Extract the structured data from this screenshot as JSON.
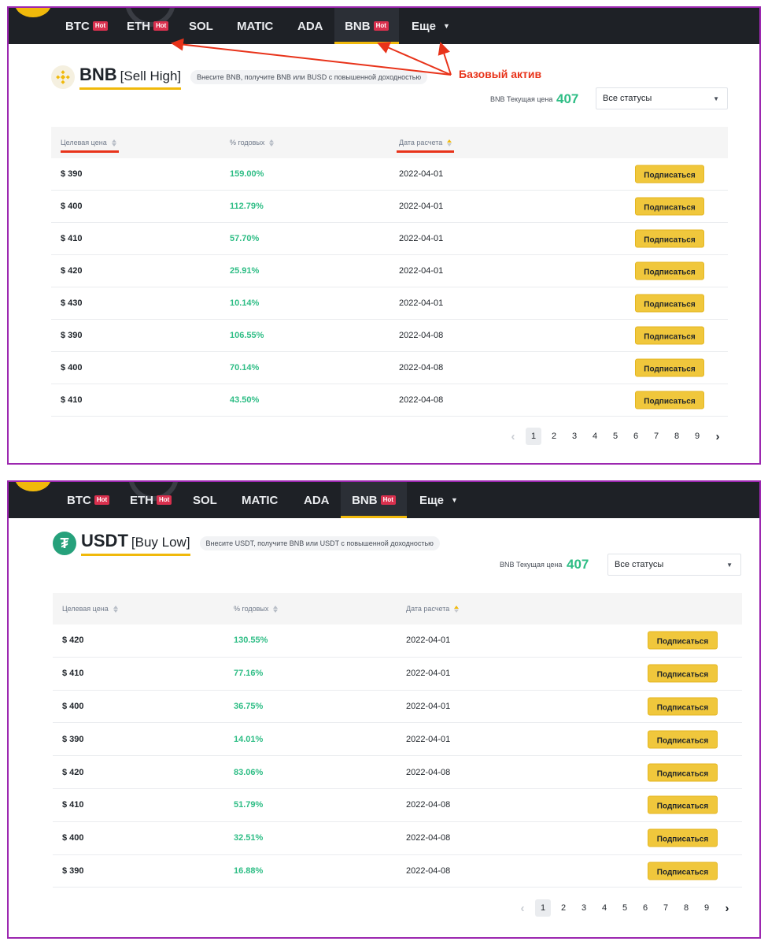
{
  "nav": {
    "tabs": [
      {
        "label": "BTC",
        "hot": "Hot"
      },
      {
        "label": "ETH",
        "hot": "Hot"
      },
      {
        "label": "SOL"
      },
      {
        "label": "MATIC"
      },
      {
        "label": "ADA"
      },
      {
        "label": "BNB",
        "hot": "Hot",
        "active": true
      },
      {
        "label": "Еще"
      }
    ]
  },
  "annotation": {
    "label": "Базовый актив",
    "color": "#e8331a"
  },
  "panels": [
    {
      "asset": "BNB",
      "mode": "[Sell High]",
      "description": "Внесите BNB, получите BNB или BUSD с повышенной доходностью",
      "price_label": "BNB Текущая цена",
      "price_value": "407",
      "status_select": "Все статусы",
      "columns": [
        "Целевая цена",
        "% годовых",
        "Дата расчета"
      ],
      "button_label": "Подписаться",
      "rows": [
        {
          "price": "$ 390",
          "apy": "159.00%",
          "date": "2022-04-01"
        },
        {
          "price": "$ 400",
          "apy": "112.79%",
          "date": "2022-04-01"
        },
        {
          "price": "$ 410",
          "apy": "57.70%",
          "date": "2022-04-01"
        },
        {
          "price": "$ 420",
          "apy": "25.91%",
          "date": "2022-04-01"
        },
        {
          "price": "$ 430",
          "apy": "10.14%",
          "date": "2022-04-01"
        },
        {
          "price": "$ 390",
          "apy": "106.55%",
          "date": "2022-04-08"
        },
        {
          "price": "$ 400",
          "apy": "70.14%",
          "date": "2022-04-08"
        },
        {
          "price": "$ 410",
          "apy": "43.50%",
          "date": "2022-04-08"
        }
      ],
      "pages": [
        "1",
        "2",
        "3",
        "4",
        "5",
        "6",
        "7",
        "8",
        "9"
      ],
      "current_page": "1"
    },
    {
      "asset": "USDT",
      "mode": "[Buy Low]",
      "description": "Внесите USDT, получите BNB или USDT с повышенной доходностью",
      "price_label": "BNB Текущая цена",
      "price_value": "407",
      "status_select": "Все статусы",
      "columns": [
        "Целевая цена",
        "% годовых",
        "Дата расчета"
      ],
      "button_label": "Подписаться",
      "rows": [
        {
          "price": "$ 420",
          "apy": "130.55%",
          "date": "2022-04-01"
        },
        {
          "price": "$ 410",
          "apy": "77.16%",
          "date": "2022-04-01"
        },
        {
          "price": "$ 400",
          "apy": "36.75%",
          "date": "2022-04-01"
        },
        {
          "price": "$ 390",
          "apy": "14.01%",
          "date": "2022-04-01"
        },
        {
          "price": "$ 420",
          "apy": "83.06%",
          "date": "2022-04-08"
        },
        {
          "price": "$ 410",
          "apy": "51.79%",
          "date": "2022-04-08"
        },
        {
          "price": "$ 400",
          "apy": "32.51%",
          "date": "2022-04-08"
        },
        {
          "price": "$ 390",
          "apy": "16.88%",
          "date": "2022-04-08"
        }
      ],
      "pages": [
        "1",
        "2",
        "3",
        "4",
        "5",
        "6",
        "7",
        "8",
        "9"
      ],
      "current_page": "1"
    }
  ],
  "colors": {
    "accent": "#f0b90b",
    "positive": "#2ebd85",
    "navbar": "#1e2126",
    "hot": "#d9304e",
    "frame": "#9c27b0"
  },
  "icons": {
    "bnb": "bnb-coin-icon",
    "usdt": "tether-coin-icon",
    "dropdown": "chevron-down-icon",
    "sort": "sort-icon"
  }
}
